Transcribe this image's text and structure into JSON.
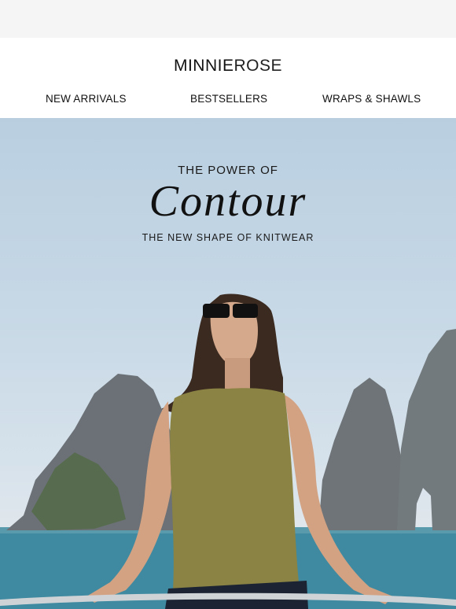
{
  "brand": {
    "logo_bold": "MINNIE",
    "logo_light": "ROSE"
  },
  "nav": {
    "items": [
      {
        "label": "NEW ARRIVALS"
      },
      {
        "label": "BESTSELLERS"
      },
      {
        "label": "WRAPS & SHAWLS"
      }
    ]
  },
  "hero": {
    "kicker": "THE POWER OF",
    "title": "Contour",
    "subtitle": "THE NEW SHAPE OF KNITWEAR"
  },
  "colors": {
    "sky_top": "#b9cfe0",
    "sea": "#3f8aa0",
    "rock": "#6e7478",
    "top_garment": "#8a8344",
    "hair": "#3a2a20"
  }
}
